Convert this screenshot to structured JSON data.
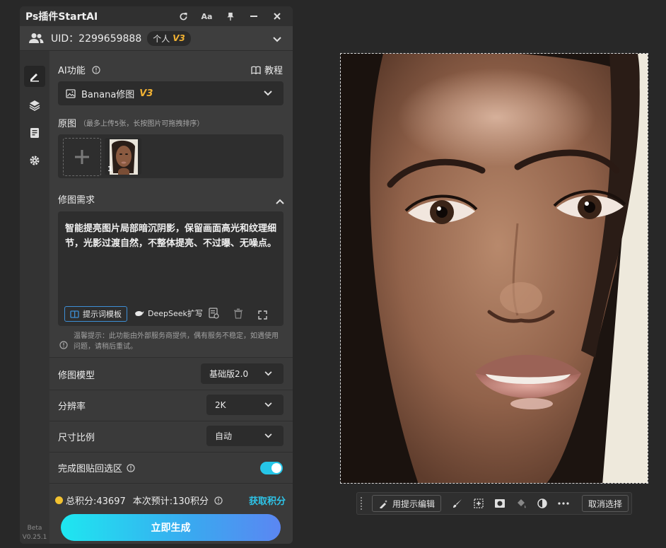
{
  "panel": {
    "title": "Ps插件StartAI",
    "uid_text": "UID：2299659888",
    "account_type": "个人",
    "account_version": "V3",
    "version_tag": "Beta",
    "version_number": "V0.25.1"
  },
  "ai": {
    "label": "AI功能",
    "tutorial": "教程",
    "feature_name": "Banana修图",
    "feature_version": "V3"
  },
  "source": {
    "label": "原图",
    "hint": "（最多上传5张，长按图片可拖拽排序）",
    "thumb_index": "1"
  },
  "request": {
    "label": "修图需求",
    "prompt": "智能提亮图片局部暗沉阴影，保留画面高光和纹理细节，光影过渡自然，不整体提亮、不过曝、无噪点。",
    "template_button": "提示词模板",
    "deepseek_button": "DeepSeek扩写",
    "notice": "温馨提示：此功能由外部服务商提供，偶有服务不稳定，如遇使用问题，请稍后重试。"
  },
  "settings": {
    "model_label": "修图模型",
    "model_value": "基础版2.0",
    "resolution_label": "分辨率",
    "resolution_value": "2K",
    "ratio_label": "尺寸比例",
    "ratio_value": "自动",
    "paste_back_label": "完成图贴回选区",
    "paste_back_on": true
  },
  "footer": {
    "credits": "总积分:43697",
    "estimate": "本次预计:130积分",
    "get_points": "获取积分",
    "generate": "立即生成"
  },
  "context_bar": {
    "edit_with_prompt": "用提示编辑",
    "deselect": "取消选择"
  },
  "colors": {
    "accent": "#26c6e8",
    "v3": "#f2b233",
    "gradient_start": "#1ee7f0",
    "gradient_end": "#5b86f2"
  }
}
